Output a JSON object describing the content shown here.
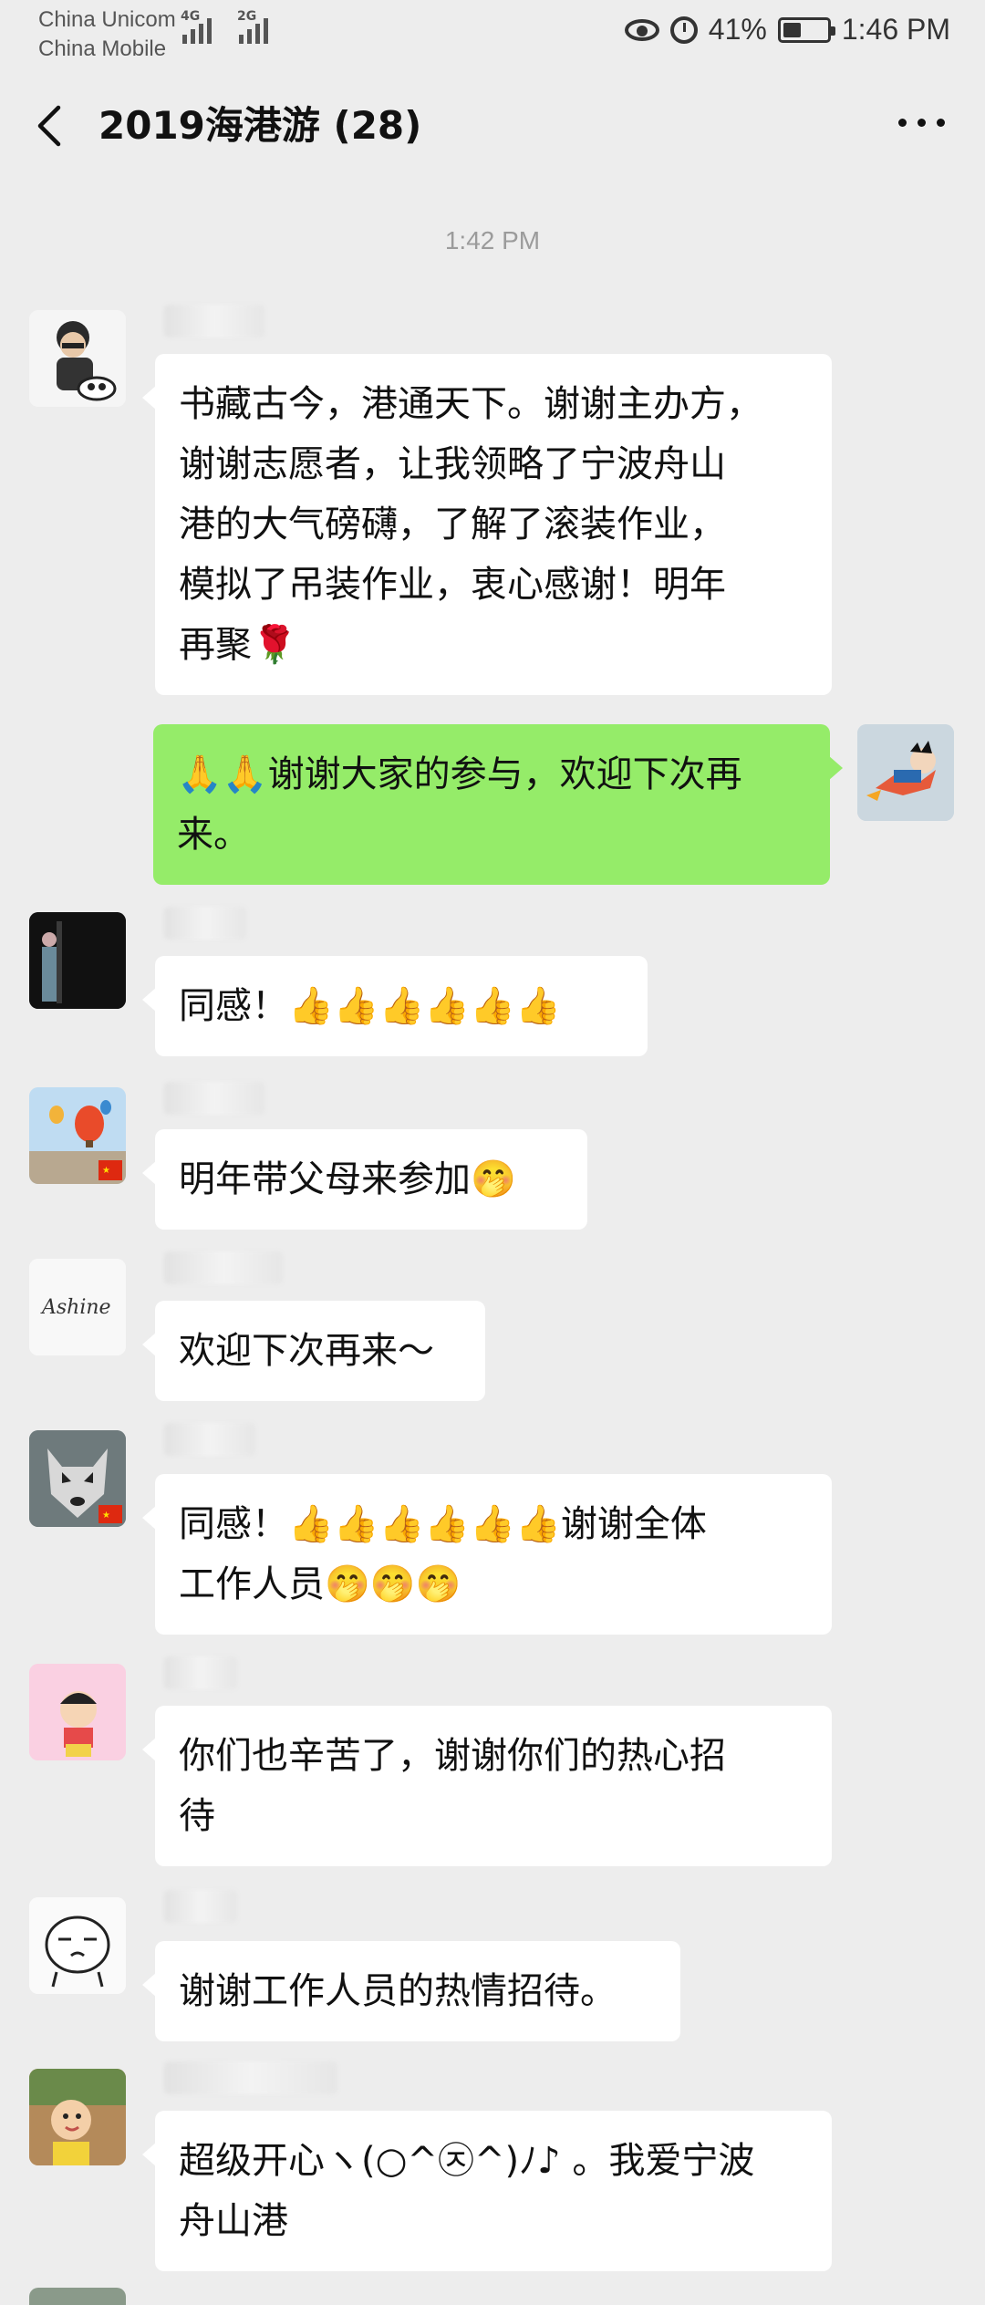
{
  "status_bar": {
    "carrier1": "China Unicom",
    "carrier2": "China Mobile",
    "sig1": "4G",
    "sig2": "2G",
    "battery": "41%",
    "battery_level": 0.41,
    "time": "1:46 PM"
  },
  "header": {
    "title": "2019海港游 (28)"
  },
  "timestamp": "1:42 PM",
  "messages": [
    {
      "side": "left",
      "text": "书藏古今，港通天下。谢谢主办方，谢谢志愿者，让我领略了宁波舟山港的大气磅礴，了解了滚装作业，模拟了吊装作业，衷心感谢！明年再聚🌹",
      "line1": "书藏古今，港通天下。谢谢主办方，",
      "line2": "谢谢志愿者，让我领略了宁波舟山",
      "line3": "港的大气磅礴，了解了滚装作业，",
      "line4": "模拟了吊装作业，衷心感谢！明年",
      "line5": "再聚🌹"
    },
    {
      "side": "right",
      "line1": "🙏🙏谢谢大家的参与，欢迎下次再",
      "line2": "来。"
    },
    {
      "side": "left",
      "line1": "同感！👍👍👍👍👍👍"
    },
    {
      "side": "left",
      "line1": "明年带父母来参加🤭"
    },
    {
      "side": "left",
      "line1": "欢迎下次再来～"
    },
    {
      "side": "left",
      "line1": "同感！👍👍👍👍👍👍谢谢全体",
      "line2": "工作人员🤭🤭🤭"
    },
    {
      "side": "left",
      "line1": "你们也辛苦了，谢谢你们的热心招",
      "line2": "待"
    },
    {
      "side": "left",
      "line1": "谢谢工作人员的热情招待。"
    },
    {
      "side": "left",
      "line1": "超级开心ヽ(○^㉨^)ﾉ♪ 。我爱宁波",
      "line2": "舟山港"
    }
  ],
  "avatars": {
    "ashine_text": "Ashine"
  },
  "colors": {
    "background": "#ededed",
    "bubble_self": "#95ec69",
    "bubble_other": "#ffffff"
  },
  "icons": {
    "back": "back-arrow-icon",
    "more": "more-dots-icon",
    "eye": "eye-icon",
    "alarm": "alarm-icon",
    "battery": "battery-icon"
  }
}
